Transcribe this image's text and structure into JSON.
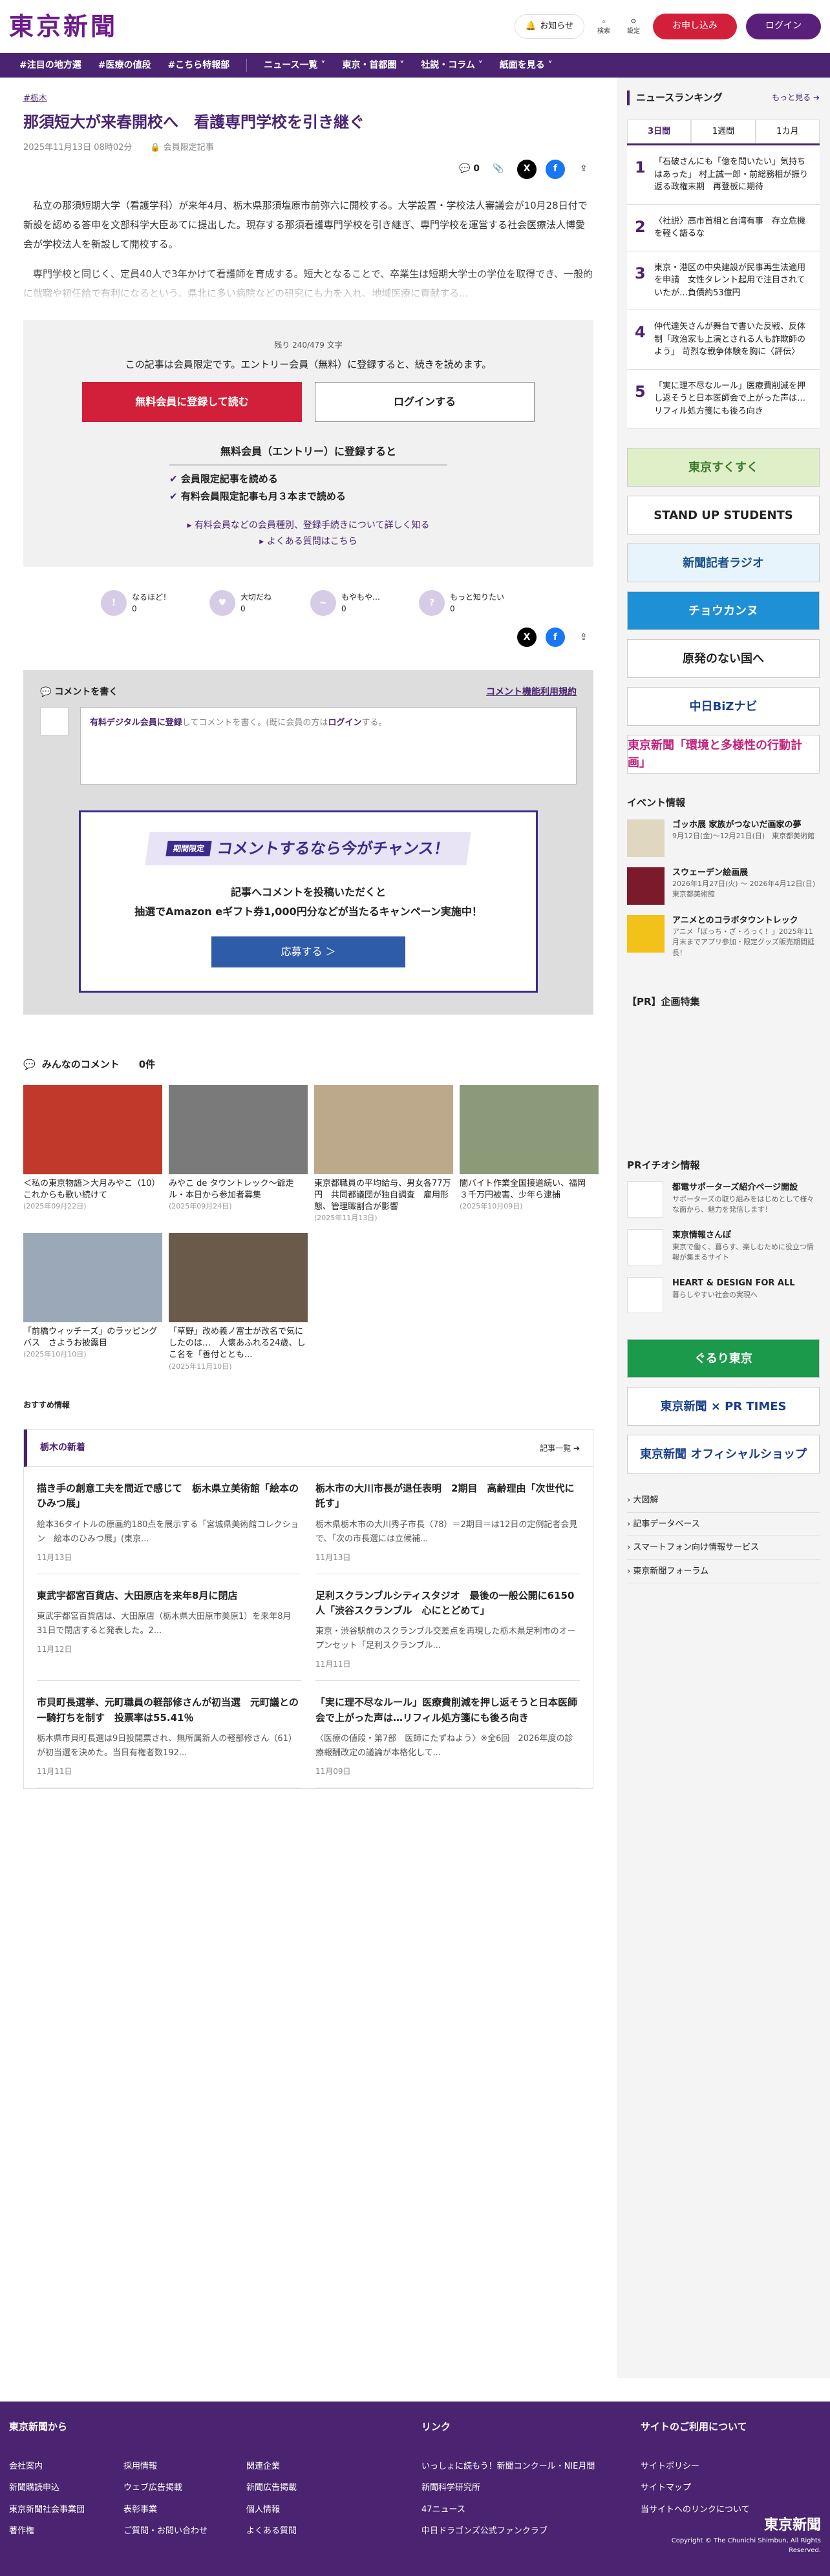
{
  "header": {
    "logo": "東京新聞",
    "notice_label": "お知らせ",
    "search_label": "検索",
    "settings_label": "設定",
    "apply_label": "お申し込み",
    "login_label": "ログイン"
  },
  "nav": {
    "items": [
      "#注目の地方選",
      "#医療の値段",
      "#こちら特報部",
      "ニュース一覧 ˅",
      "東京・首都圏 ˅",
      "社説・コラム ˅",
      "紙面を見る ˅"
    ]
  },
  "article": {
    "tag": "#栃木",
    "title": "那須短大が来春開校へ　看護専門学校を引き継ぐ",
    "date": "2025年11月13日 08時02分",
    "member_label": "会員限定記事",
    "comment_count": "0",
    "paragraphs": [
      "私立の那須短期大学（看護学科）が来年4月、栃木県那須塩原市前弥六に開校する。大学設置・学校法人審議会が10月28日付で新設を認める答申を文部科学大臣あてに提出した。現存する那須看護専門学校を引き継ぎ、専門学校を運営する社会医療法人博愛会が学校法人を新設して開校する。",
      "専門学校と同じく、定員40人で3年かけて看護師を育成する。短大となることで、卒業生は短期大学士の学位を取得でき、一般的に就職や初任給で有利になるという。県北に多い病院などの研究にも力を入れ、地域医療に貢献する..."
    ]
  },
  "paywall": {
    "remaining": "残り 240/479 文字",
    "lead": "この記事は会員限定です。エントリー会員（無料）に登録すると、続きを読めます。",
    "register_btn": "無料会員に登録して読む",
    "login_btn": "ログインする",
    "entry_heading": "無料会員（エントリー）に登録すると",
    "benefits": [
      "会員限定記事を読める",
      "有料会員限定記事も月３本まで読める"
    ],
    "link1": "有料会員などの会員種別、登録手続きについて詳しく知る",
    "link2": "よくある質問はこちら"
  },
  "reactions": [
    {
      "label": "なるほど！",
      "count": "0",
      "icon": "!"
    },
    {
      "label": "大切だね",
      "count": "0",
      "icon": "♥"
    },
    {
      "label": "もやもや…",
      "count": "0",
      "icon": "~"
    },
    {
      "label": "もっと知りたい",
      "count": "0",
      "icon": "?"
    }
  ],
  "comments": {
    "write_label": "コメントを書く",
    "rules_label": "コメント機能利用規約",
    "placeholder_a": "有料デジタル会員に登録",
    "placeholder_b": "してコメントを書く。(既に会員の方は",
    "placeholder_c": "ログイン",
    "placeholder_d": "する。",
    "campaign_limited": "期間限定",
    "campaign_title": "コメントするなら今がチャンス！",
    "campaign_line1": "記事へコメントを投稿いただくと",
    "campaign_line2": "抽選でAmazon eギフト券1,000円分などが当たるキャンペーン実施中！",
    "apply_label": "応募する ＞",
    "all_label": "みんなのコメント",
    "all_count": "0件"
  },
  "cards": [
    {
      "title": "＜私の東京物語＞大月みやこ（10）　これからも歌い続けて",
      "date": "(2025年09月22日)",
      "color": "#c0392b"
    },
    {
      "title": "みやこ de タウントレック～爺走ル・本日から参加者募集",
      "date": "(2025年09月24日)",
      "color": "#7a7a7a"
    },
    {
      "title": "東京都職員の平均給与、男女各77万円　共同都議団が独自調査　雇用形態、管理職割合が影響",
      "date": "(2025年11月13日)",
      "color": "#bca88a"
    },
    {
      "title": "闇バイト作業全国接道続い、福岡　３千万円被害、少年ら逮捕",
      "date": "(2025年10月09日)",
      "color": "#8c9a7a"
    },
    {
      "title": "「前橋ウィッチーズ」のラッピングバス　さようお披露目",
      "date": "(2025年10月10日)",
      "color": "#9aa8b8"
    },
    {
      "title": "「草野」改め義ノ富士が改名で気にしたのは…　人懐あふれる24歳、しこ名を「善付ととも...",
      "date": "(2025年11月10日)",
      "color": "#6a5a4a"
    }
  ],
  "osusume": "おすすめ情報",
  "local": {
    "heading": "栃木の新着",
    "more": "記事一覧 ➔",
    "items": [
      {
        "title": "描き手の創意工夫を間近で感じて　栃木県立美術館「絵本のひみつ展」",
        "text": "絵本36タイトルの原画約180点を展示する「宮城県美術館コレクション　絵本のひみつ展」(東京...",
        "date": "11月13日"
      },
      {
        "title": "栃木市の大川市長が退任表明　2期目　高齢理由「次世代に託す」",
        "text": "栃木県栃木市の大川秀子市長（78）＝2期目＝は12日の定例記者会見で、「次の市長選には立候補...",
        "date": "11月13日"
      },
      {
        "title": "東武宇都宮百貨店、大田原店を来年8月に閉店",
        "text": "東武宇都宮百貨店は、大田原店（栃木県大田原市美原1）を来年8月31日で閉店すると発表した。2...",
        "date": "11月12日"
      },
      {
        "title": "足利スクランブルシティスタジオ　最後の一般公開に6150人「渋谷スクランブル　心にとどめて」",
        "text": "東京・渋谷駅前のスクランブル交差点を再現した栃木県足利市のオープンセット「足利スクランブル...",
        "date": "11月11日"
      },
      {
        "title": "市貝町長選挙、元町職員の軽部修さんが初当選　元町議との一騎打ちを制す　投票率は55.41％",
        "text": "栃木県市貝町長選は9日投開票され、無所属新人の軽部修さん（61）が初当選を決めた。当日有権者数192...",
        "date": "11月11日"
      },
      {
        "title": "「実に理不尽なルール」医療費削減を押し返そうと日本医師会で上がった声は…リフィル処方箋にも後ろ向き",
        "text": "〈医療の値段・第7部　医師にたずねよう〉※全6回　2026年度の診療報酬改定の議論が本格化して...",
        "date": "11月09日"
      }
    ]
  },
  "side": {
    "rank_heading": "ニュースランキング",
    "rank_more": "もっと見る ➔",
    "tabs": [
      "3日間",
      "1週間",
      "1カ月"
    ],
    "ranking": [
      "「石破さんにも「億を問いたい」気持ちはあった」 村上誠一郎・前総務相が振り返る政権末期　再登板に期待",
      "〈社説〉高市首相と台湾有事　存立危機を軽く語るな",
      "東京・港区の中央建設が民事再生法適用を申請　女性タレント起用で注目されていたが…負債約53億円",
      "仲代達矢さんが舞台で書いた反戦、反体制「政治家も上演とされる人も詐欺師のよう」 苛烈な戦争体験を胸に〈評伝〉",
      "「実に理不尽なルール」医療費削減を押し返そうと日本医師会で上がった声は…リフィル処方箋にも後ろ向き"
    ],
    "banners": [
      {
        "label": "東京すくすく",
        "bg": "#dff0c8",
        "fg": "#3a7a2a"
      },
      {
        "label": "STAND UP STUDENTS",
        "bg": "#ffffff",
        "fg": "#222222"
      },
      {
        "label": "新聞記者ラジオ",
        "bg": "#e8f4fb",
        "fg": "#1a4e8a"
      },
      {
        "label": "チョウカンヌ",
        "bg": "#1e90d6",
        "fg": "#ffffff"
      },
      {
        "label": "原発のない国へ",
        "bg": "#ffffff",
        "fg": "#222222"
      },
      {
        "label": "中日BiZナビ",
        "bg": "#ffffff",
        "fg": "#1a3e8a"
      },
      {
        "label": "東京新聞「環境と多様性の行動計画」",
        "bg": "#ffffff",
        "fg": "#c0237a"
      }
    ],
    "events_heading": "イベント情報",
    "events": [
      {
        "title": "ゴッホ展 家族がつないだ画家の夢",
        "sub": "9月12日(金)～12月21日(日)　東京都美術館",
        "color": "#e0d7c0"
      },
      {
        "title": "スウェーデン絵画展",
        "sub": "2026年1月27日(火) ～ 2026年4月12日(日)　東京都美術館",
        "color": "#7a1a2a"
      },
      {
        "title": "アニメとのコラボタウントレック",
        "sub": "アニメ「ぼっち・ざ・ろっく！」2025年11月末までアプリ参加・限定グッズ販売期間延長！",
        "color": "#f2c21a"
      }
    ],
    "pr_heading": "【PR】企画特集",
    "pr2_heading": "PRイチオシ情報",
    "pr": [
      {
        "title": "都電サポーターズ紹介ページ開設",
        "sub": "サポーターズの取り組みをはじめとして様々な面から、魅力を発信します！"
      },
      {
        "title": "東京情報さんぽ",
        "sub": "東京で働く、暮らす、楽しむために役立つ情報が集まるサイト"
      },
      {
        "title": "HEART & DESIGN FOR ALL",
        "sub": "暮らしやすい社会の実現へ"
      }
    ],
    "banners2": [
      {
        "label": "ぐるり東京",
        "bg": "#1a9a4a",
        "fg": "#ffffff"
      },
      {
        "label": "東京新聞 × PR TIMES",
        "bg": "#ffffff",
        "fg": "#1a3e8a"
      },
      {
        "label": "東京新聞 オフィシャルショップ",
        "bg": "#ffffff",
        "fg": "#1a3e8a"
      }
    ],
    "links": [
      "大図解",
      "記事データベース",
      "スマートフォン向け情報サービス",
      "東京新聞フォーラム"
    ]
  },
  "footer": {
    "col1_heading": "東京新聞から",
    "col1_a": [
      "会社案内",
      "新聞購読申込",
      "東京新聞社会事業団",
      "著作権"
    ],
    "col1_b": [
      "採用情報",
      "ウェブ広告掲載",
      "表彰事業",
      "ご質問・お問い合わせ"
    ],
    "col1_c": [
      "関連企業",
      "新聞広告掲載",
      "個人情報",
      "よくある質問"
    ],
    "col2_heading": "リンク",
    "col2": [
      "いっしょに読もう！新聞コンクール・NIE月間",
      "新聞科学研究所",
      "47ニュース",
      "中日ドラゴンズ公式ファンクラブ"
    ],
    "col3_heading": "サイトのご利用について",
    "col3": [
      "サイトポリシー",
      "サイトマップ",
      "当サイトへのリンクについて"
    ],
    "logo": "東京新聞",
    "copyright": "Copyright © The Chunichi Shimbun, All Rights Reserved."
  }
}
